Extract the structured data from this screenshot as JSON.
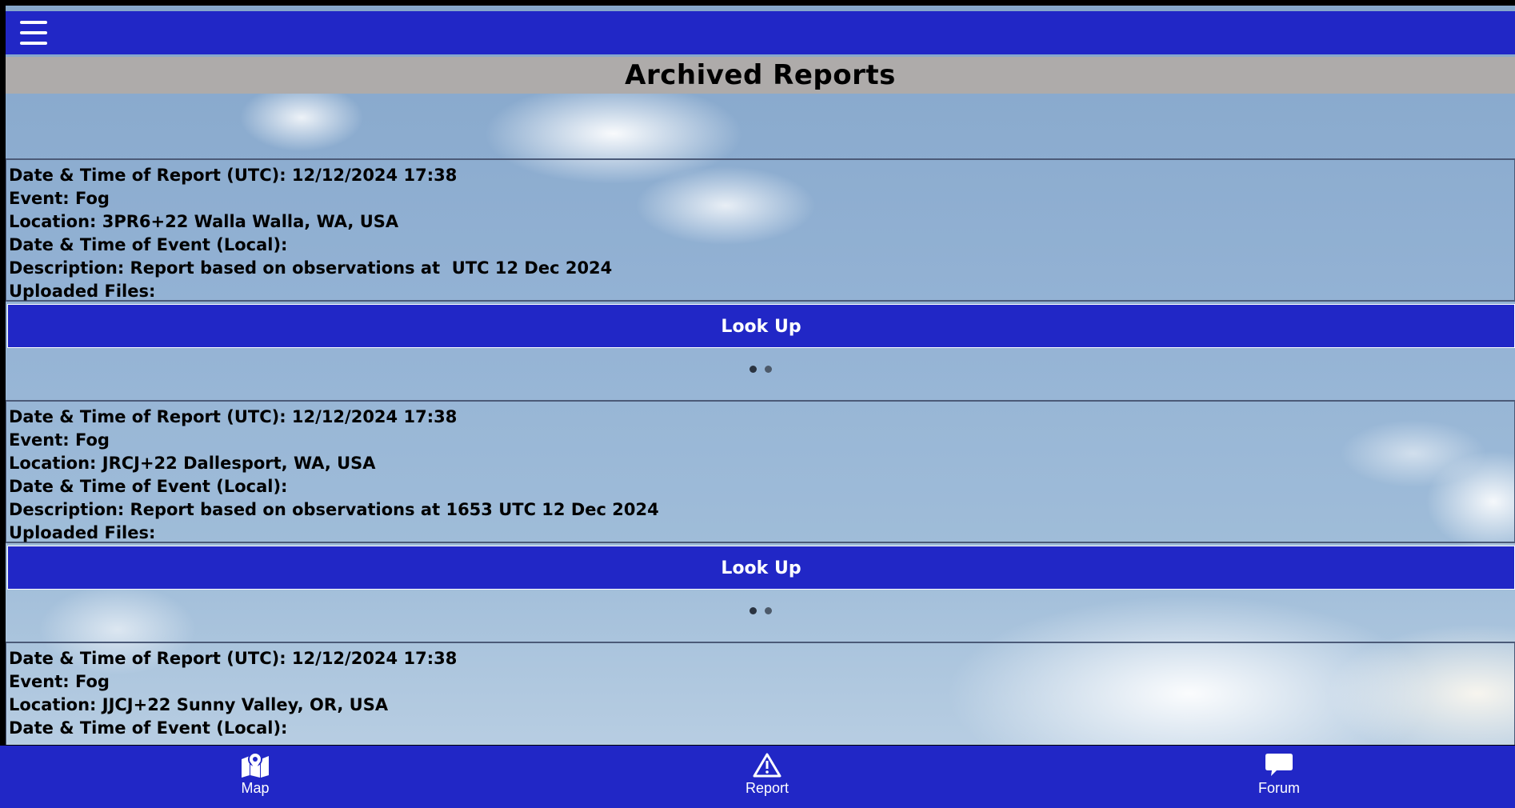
{
  "header": {
    "menu_icon": "hamburger-menu-icon",
    "bar_color": "#2127c6"
  },
  "page": {
    "title": "Archived Reports"
  },
  "reports": [
    {
      "report_time": "Date & Time of Report (UTC): 12/12/2024 17:38",
      "event": "Event: Fog",
      "location": "Location: 3PR6+22 Walla Walla, WA, USA",
      "event_time": "Date & Time of Event (Local):",
      "description": "Description: Report based on observations at  UTC 12 Dec 2024",
      "files": "Uploaded Files:",
      "button": "Look Up"
    },
    {
      "report_time": "Date & Time of Report (UTC): 12/12/2024 17:38",
      "event": "Event: Fog",
      "location": "Location: JRCJ+22 Dallesport, WA, USA",
      "event_time": "Date & Time of Event (Local):",
      "description": "Description: Report based on observations at 1653 UTC 12 Dec 2024",
      "files": "Uploaded Files:",
      "button": "Look Up"
    },
    {
      "report_time": "Date & Time of Report (UTC): 12/12/2024 17:38",
      "event": "Event: Fog",
      "location": "Location: JJCJ+22 Sunny Valley, OR, USA",
      "event_time": "Date & Time of Event (Local):"
    }
  ],
  "bottom_nav": [
    {
      "label": "Map",
      "icon": "map-pin-icon"
    },
    {
      "label": "Report",
      "icon": "warning-triangle-icon"
    },
    {
      "label": "Forum",
      "icon": "chat-bubble-icon"
    }
  ]
}
